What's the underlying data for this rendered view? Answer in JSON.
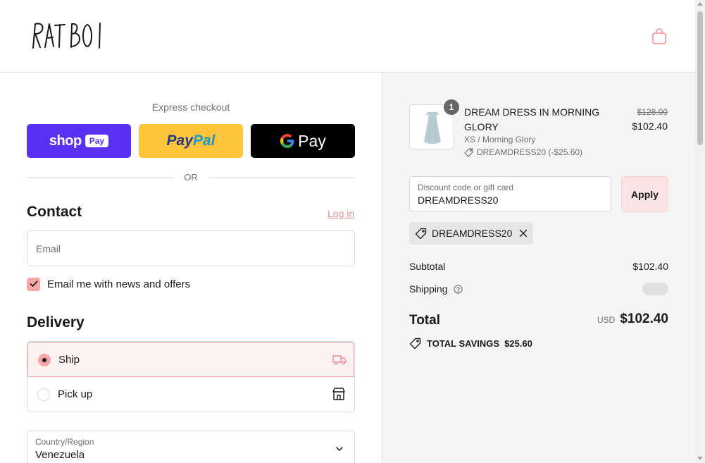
{
  "brand": {
    "logo_text": "RAT BOI"
  },
  "express": {
    "label": "Express checkout",
    "shop_text": "shop",
    "shop_badge": "Pay",
    "paypal_pay": "Pay",
    "paypal_pal": "Pal",
    "gpay_g": "G",
    "gpay_text": "Pay",
    "or_text": "OR"
  },
  "contact": {
    "heading": "Contact",
    "login_link": "Log in",
    "email_placeholder": "Email",
    "newsletter_label": "Email me with news and offers",
    "newsletter_checked": true
  },
  "delivery": {
    "heading": "Delivery",
    "options": [
      {
        "label": "Ship",
        "selected": true,
        "icon": "truck-icon"
      },
      {
        "label": "Pick up",
        "selected": false,
        "icon": "store-icon"
      }
    ],
    "country_label": "Country/Region",
    "country_value": "Venezuela"
  },
  "order": {
    "item": {
      "quantity": "1",
      "name": "DREAM DRESS IN MORNING GLORY",
      "variant": "XS / Morning Glory",
      "discount": "DREAMDRESS20 (-$25.60)",
      "price_original": "$128.00",
      "price": "$102.40"
    },
    "discount_field": {
      "label": "Discount code or gift card",
      "value": "DREAMDRESS20",
      "apply_label": "Apply"
    },
    "applied_code": "DREAMDRESS20",
    "subtotal_label": "Subtotal",
    "subtotal_value": "$102.40",
    "shipping_label": "Shipping",
    "total_label": "Total",
    "currency": "USD",
    "total_value": "$102.40",
    "savings_label": "TOTAL SAVINGS",
    "savings_value": "$25.60"
  },
  "colors": {
    "accent": "#f7a7a7",
    "shop_pay": "#5a31f4",
    "paypal": "#ffc439",
    "gpay": "#000000"
  }
}
